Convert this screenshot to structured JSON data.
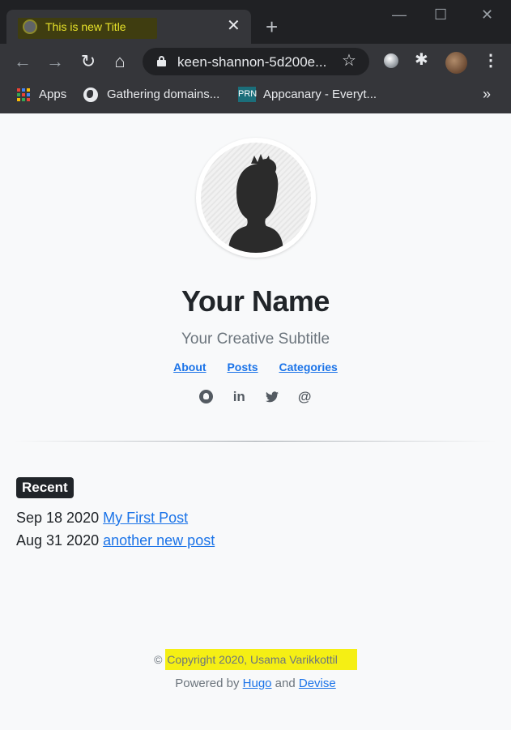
{
  "browser": {
    "tab": {
      "title": "This is new Title",
      "close_glyph": "✕",
      "favicon": "globe-icon"
    },
    "new_tab_glyph": "+",
    "window_controls": {
      "minimize": "—",
      "maximize": "☐",
      "close": "✕"
    },
    "toolbar": {
      "back": "←",
      "forward": "→",
      "reload": "↻",
      "home": "⌂",
      "url": "keen-shannon-5d200e...",
      "star": "☆",
      "extensions_glyph": "✱",
      "menu_glyph": "⋮"
    },
    "bookmarks": [
      {
        "label": "Apps",
        "icon": "apps-grid-icon"
      },
      {
        "label": "Gathering domains...",
        "icon": "globe-icon"
      },
      {
        "label": "Appcanary - Everyt...",
        "icon": "prn-icon",
        "icon_text": "PRN"
      }
    ],
    "bookmarks_overflow": "»",
    "colors": {
      "tab_highlight": "#3f3d10",
      "tab_title": "#e8e32a"
    }
  },
  "profile": {
    "name": "Your Name",
    "subtitle": "Your Creative Subtitle"
  },
  "nav": [
    {
      "label": "About"
    },
    {
      "label": "Posts"
    },
    {
      "label": "Categories"
    }
  ],
  "social": [
    {
      "icon": "github-icon"
    },
    {
      "icon": "linkedin-icon",
      "glyph": "in"
    },
    {
      "icon": "twitter-icon",
      "glyph": "🐦"
    },
    {
      "icon": "email-icon",
      "glyph": "@"
    }
  ],
  "recent": {
    "label": "Recent",
    "posts": [
      {
        "date": "Sep 18 2020",
        "title": "My First Post"
      },
      {
        "date": "Aug 31 2020",
        "title": "another new post"
      }
    ]
  },
  "footer": {
    "copyright_symbol": "©",
    "copyright_text": "Copyright 2020, Usama Varikkottil",
    "powered_prefix": "Powered by",
    "hugo": "Hugo",
    "and": "and",
    "devise": "Devise"
  },
  "colors": {
    "link": "#1a73e8",
    "highlight": "#f5ef14",
    "badge_bg": "#212529"
  }
}
